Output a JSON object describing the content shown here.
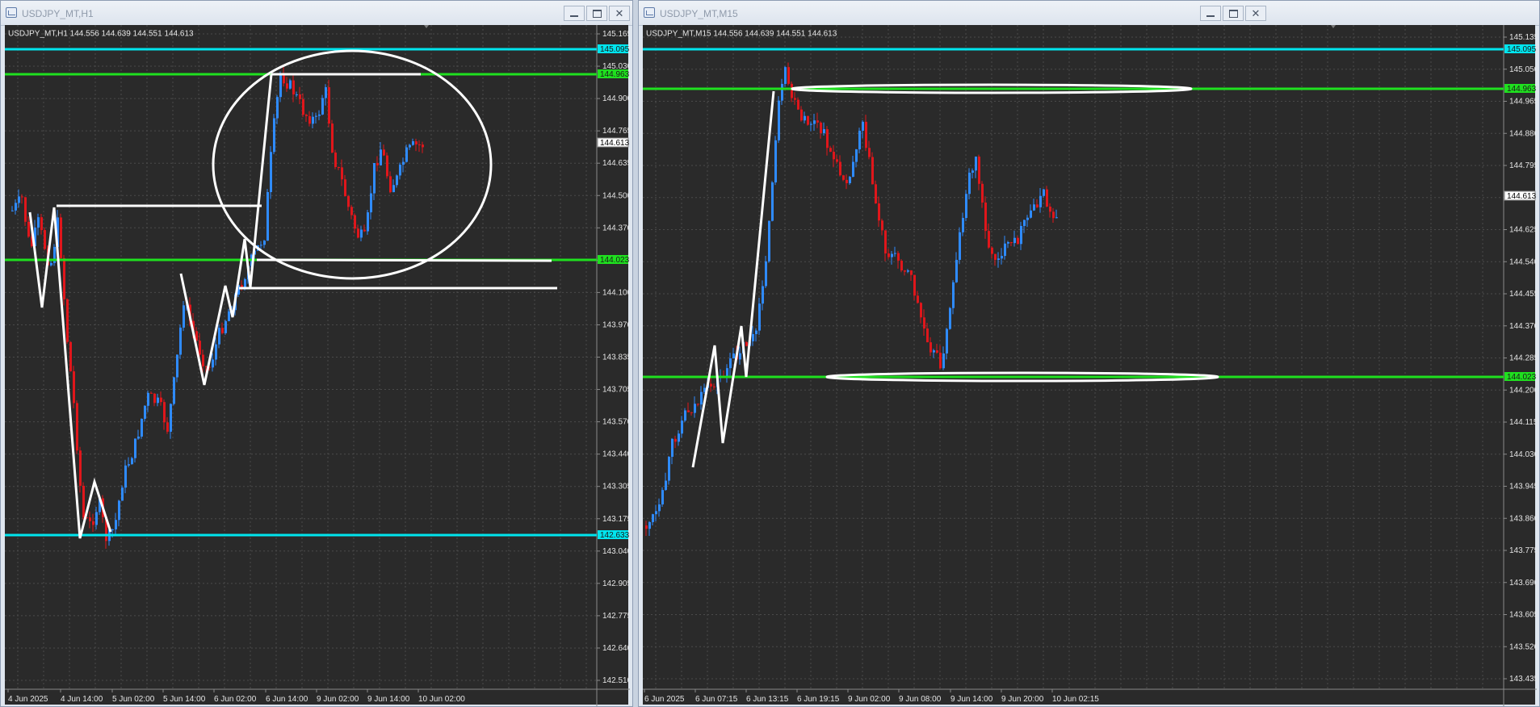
{
  "windows": [
    {
      "id": "h1",
      "title": "USDJPY_MT,H1",
      "symbol_line": "USDJPY_MT,H1  144.556 144.639 144.551 144.613",
      "price_ticks": [
        "145.165",
        "145.030",
        "144.900",
        "144.765",
        "144.635",
        "144.500",
        "144.370",
        "144.235",
        "144.100",
        "143.970",
        "143.835",
        "143.705",
        "143.570",
        "143.440",
        "143.305",
        "143.175",
        "143.040",
        "142.905",
        "142.775",
        "142.640",
        "142.510"
      ],
      "time_ticks": [
        "4 Jun 2025",
        "4 Jun 14:00",
        "5 Jun 02:00",
        "5 Jun 14:00",
        "6 Jun 02:00",
        "6 Jun 14:00",
        "9 Jun 02:00",
        "9 Jun 14:00",
        "10 Jun 02:00"
      ],
      "current_price": "144.613",
      "levels": [
        {
          "label": "145.095",
          "color": "#00e5ee"
        },
        {
          "label": "144.963",
          "color": "#1fe01f"
        },
        {
          "label": "144.023",
          "color": "#1fe01f"
        },
        {
          "label": "142.633",
          "color": "#00e5ee"
        }
      ]
    },
    {
      "id": "m15",
      "title": "USDJPY_MT,M15",
      "symbol_line": "USDJPY_MT,M15  144.556 144.639 144.551 144.613",
      "price_ticks": [
        "145.135",
        "145.050",
        "144.965",
        "144.880",
        "144.795",
        "144.710",
        "144.625",
        "144.540",
        "144.455",
        "144.370",
        "144.285",
        "144.200",
        "144.115",
        "144.030",
        "143.945",
        "143.860",
        "143.775",
        "143.690",
        "143.605",
        "143.520",
        "143.435"
      ],
      "time_ticks": [
        "6 Jun 2025",
        "6 Jun 07:15",
        "6 Jun 13:15",
        "6 Jun 19:15",
        "9 Jun 02:00",
        "9 Jun 08:00",
        "9 Jun 14:00",
        "9 Jun 20:00",
        "10 Jun 02:15"
      ],
      "current_price": "144.613",
      "levels": [
        {
          "label": "145.095",
          "color": "#00e5ee"
        },
        {
          "label": "144.963",
          "color": "#1fe01f"
        },
        {
          "label": "144.023",
          "color": "#1fe01f"
        }
      ]
    }
  ],
  "colors": {
    "bull": "#2f8bff",
    "bear": "#e0161b",
    "grid": "#4a4a4a",
    "background": "#2a2a2a",
    "drawing": "#ffffff"
  }
}
